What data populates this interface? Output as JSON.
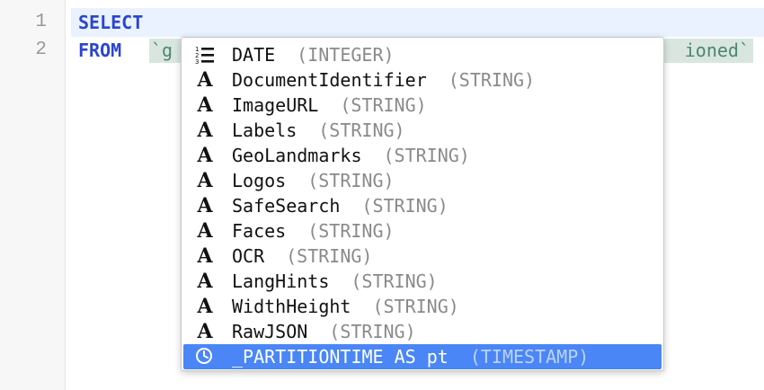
{
  "gutter": {
    "line_numbers": [
      "1",
      "2"
    ]
  },
  "code": {
    "line1_keyword": "SELECT",
    "line2_keyword": "FROM",
    "table_visible_start": "`g",
    "table_visible_end": "ioned`"
  },
  "autocomplete": {
    "items": [
      {
        "icon": "integer-list-icon",
        "name": "DATE",
        "type": "(INTEGER)"
      },
      {
        "icon": "string-a-icon",
        "name": "DocumentIdentifier",
        "type": "(STRING)"
      },
      {
        "icon": "string-a-icon",
        "name": "ImageURL",
        "type": "(STRING)"
      },
      {
        "icon": "string-a-icon",
        "name": "Labels",
        "type": "(STRING)"
      },
      {
        "icon": "string-a-icon",
        "name": "GeoLandmarks",
        "type": "(STRING)"
      },
      {
        "icon": "string-a-icon",
        "name": "Logos",
        "type": "(STRING)"
      },
      {
        "icon": "string-a-icon",
        "name": "SafeSearch",
        "type": "(STRING)"
      },
      {
        "icon": "string-a-icon",
        "name": "Faces",
        "type": "(STRING)"
      },
      {
        "icon": "string-a-icon",
        "name": "OCR",
        "type": "(STRING)"
      },
      {
        "icon": "string-a-icon",
        "name": "LangHints",
        "type": "(STRING)"
      },
      {
        "icon": "string-a-icon",
        "name": "WidthHeight",
        "type": "(STRING)"
      },
      {
        "icon": "string-a-icon",
        "name": "RawJSON",
        "type": "(STRING)"
      },
      {
        "icon": "clock-icon",
        "name": "_PARTITIONTIME AS pt",
        "type": "(TIMESTAMP)",
        "selected": true
      }
    ],
    "string_icon_glyph": "A"
  },
  "colors": {
    "keyword": "#2a45cf",
    "table_text": "#4a8770",
    "table_bg": "#d9e6e0",
    "selection": "#4a86f5",
    "type_text": "#8a8a8a"
  }
}
